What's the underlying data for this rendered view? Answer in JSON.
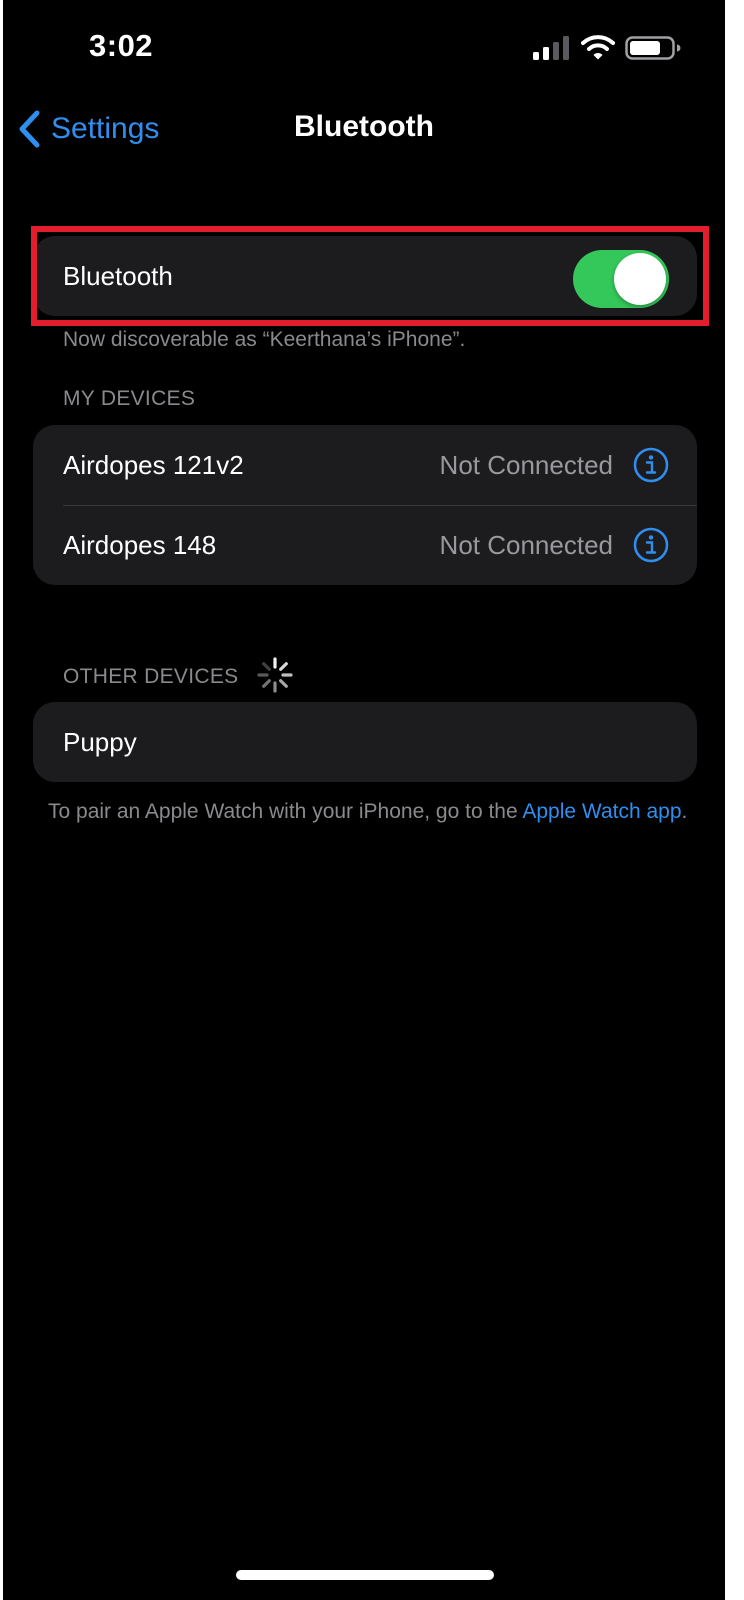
{
  "status_bar": {
    "time": "3:02",
    "icons": [
      "cellular-signal-icon",
      "wifi-icon",
      "battery-icon"
    ]
  },
  "nav": {
    "back_label": "Settings",
    "title": "Bluetooth"
  },
  "bluetooth_toggle": {
    "label": "Bluetooth",
    "on": true,
    "footer": "Now discoverable as “Keerthana’s iPhone”."
  },
  "my_devices": {
    "header": "MY DEVICES",
    "items": [
      {
        "name": "Airdopes 121v2",
        "status": "Not Connected"
      },
      {
        "name": "Airdopes 148",
        "status": "Not Connected"
      }
    ]
  },
  "other_devices": {
    "header": "OTHER DEVICES",
    "items": [
      {
        "name": "Puppy"
      }
    ]
  },
  "pair_note": {
    "text": "To pair an Apple Watch with your iPhone, go to the ",
    "link": "Apple Watch app",
    "suffix": "."
  },
  "colors": {
    "accent": "#2f8ff0",
    "toggle_on": "#34c759",
    "highlight": "#e21d2c",
    "cell_bg": "#1c1c1e"
  }
}
